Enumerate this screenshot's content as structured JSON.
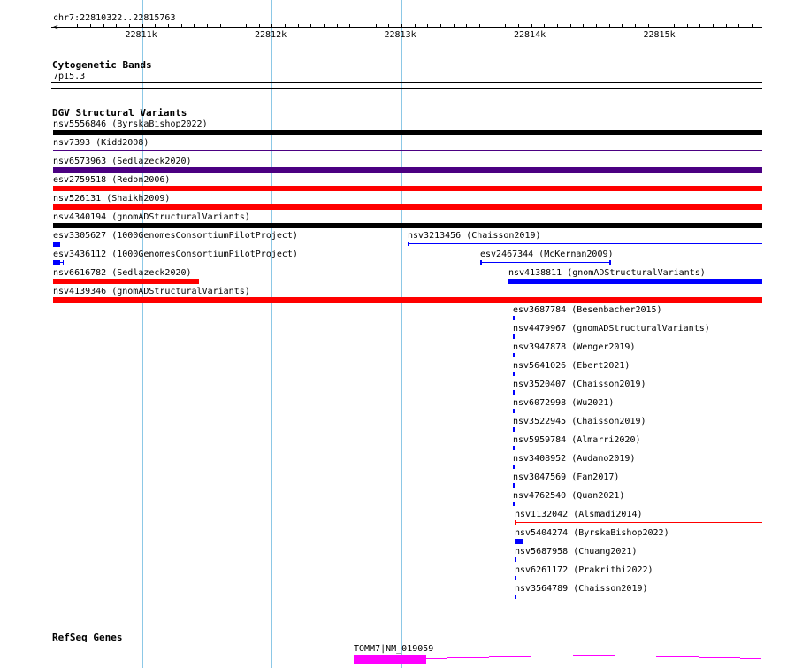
{
  "ruler": {
    "location": "chr7:22810322..22815763",
    "ticks": [
      "22811k",
      "22812k",
      "22813k",
      "22814k",
      "22815k"
    ]
  },
  "cyto": {
    "title": "Cytogenetic Bands",
    "band": "7p15.3"
  },
  "dgv": {
    "title": "DGV Structural Variants",
    "features": [
      {
        "label": "nsv5556846 (ByrskaBishop2022)",
        "color": "#000000"
      },
      {
        "label": "nsv7393 (Kidd2008)",
        "color": "#4b0082"
      },
      {
        "label": "nsv6573963 (Sedlazeck2020)",
        "color": "#4b0082"
      },
      {
        "label": "esv2759518 (Redon2006)",
        "color": "#ff0000"
      },
      {
        "label": "nsv526131 (Shaikh2009)",
        "color": "#ff0000"
      },
      {
        "label": "nsv4340194 (gnomADStructuralVariants)",
        "color": "#000000"
      },
      {
        "label": "esv3305627 (1000GenomesConsortiumPilotProject)",
        "color": "#0000ff"
      },
      {
        "label": "nsv3213456 (Chaisson2019)",
        "color": "#0000ff"
      },
      {
        "label": "esv3436112 (1000GenomesConsortiumPilotProject)",
        "color": "#0000ff"
      },
      {
        "label": "esv2467344 (McKernan2009)",
        "color": "#0000ff"
      },
      {
        "label": "nsv6616782 (Sedlazeck2020)",
        "color": "#ff0000"
      },
      {
        "label": "nsv4138811 (gnomADStructuralVariants)",
        "color": "#0000ff"
      },
      {
        "label": "nsv4139346 (gnomADStructuralVariants)",
        "color": "#ff0000"
      },
      {
        "label": "esv3687784 (Besenbacher2015)",
        "color": "#0000ff"
      },
      {
        "label": "nsv4479967 (gnomADStructuralVariants)",
        "color": "#0000ff"
      },
      {
        "label": "nsv3947878 (Wenger2019)",
        "color": "#0000ff"
      },
      {
        "label": "nsv5641026 (Ebert2021)",
        "color": "#0000ff"
      },
      {
        "label": "nsv3520407 (Chaisson2019)",
        "color": "#0000ff"
      },
      {
        "label": "nsv6072998 (Wu2021)",
        "color": "#0000ff"
      },
      {
        "label": "nsv3522945 (Chaisson2019)",
        "color": "#0000ff"
      },
      {
        "label": "nsv5959784 (Almarri2020)",
        "color": "#0000ff"
      },
      {
        "label": "nsv3408952 (Audano2019)",
        "color": "#0000ff"
      },
      {
        "label": "nsv3047569 (Fan2017)",
        "color": "#0000ff"
      },
      {
        "label": "nsv4762540 (Quan2021)",
        "color": "#0000ff"
      },
      {
        "label": "nsv1132042 (Alsmadi2014)",
        "color": "#ff0000"
      },
      {
        "label": "nsv5404274 (ByrskaBishop2022)",
        "color": "#0000ff"
      },
      {
        "label": "nsv5687958 (Chuang2021)",
        "color": "#0000ff"
      },
      {
        "label": "nsv6261172 (Prakrithi2022)",
        "color": "#0000ff"
      },
      {
        "label": "nsv3564789 (Chaisson2019)",
        "color": "#0000ff"
      }
    ]
  },
  "refseq": {
    "title": "RefSeq Genes",
    "gene": "TOMM7|NM_019059",
    "color": "#ff00ff"
  }
}
